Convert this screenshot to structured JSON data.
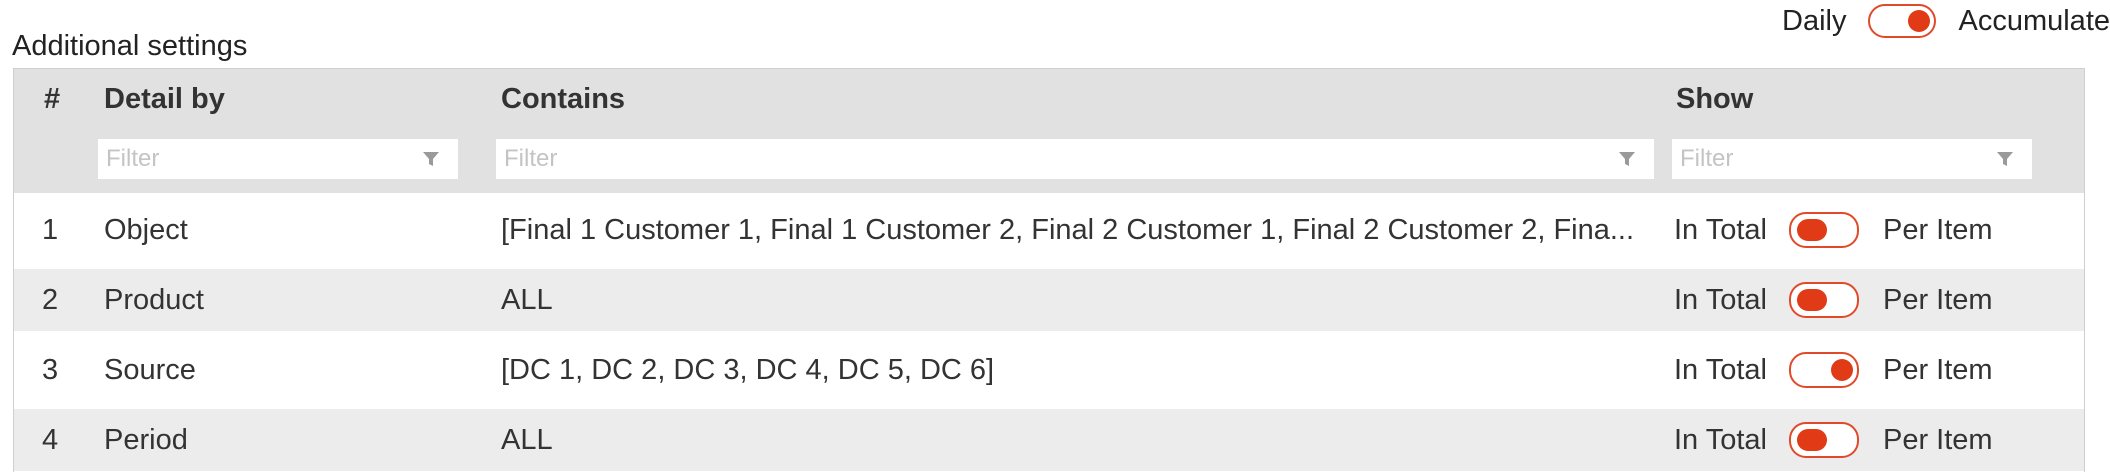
{
  "section_title": "Additional settings",
  "mode_toggle": {
    "left_label": "Daily",
    "right_label": "Accumulate",
    "state": "on"
  },
  "table": {
    "columns": {
      "num": "#",
      "detail_by": "Detail by",
      "contains": "Contains",
      "show": "Show"
    },
    "filter_placeholder": "Filter",
    "rows": [
      {
        "num": "1",
        "detail_by": "Object",
        "contains": "[Final 1 Customer 1, Final 1 Customer 2, Final 2 Customer 1, Final 2 Customer 2, Fina...",
        "left_label": "In Total",
        "right_label": "Per Item",
        "state": "off"
      },
      {
        "num": "2",
        "detail_by": "Product",
        "contains": "ALL",
        "left_label": "In Total",
        "right_label": "Per Item",
        "state": "off"
      },
      {
        "num": "3",
        "detail_by": "Source",
        "contains": "[DC 1, DC 2, DC 3, DC 4, DC 5, DC 6]",
        "left_label": "In Total",
        "right_label": "Per Item",
        "state": "on"
      },
      {
        "num": "4",
        "detail_by": "Period",
        "contains": "ALL",
        "left_label": "In Total",
        "right_label": "Per Item",
        "state": "off"
      }
    ]
  },
  "colors": {
    "accent": "#e03a16",
    "header_bg": "#e1e1e1",
    "alt_row_bg": "#ececec"
  }
}
